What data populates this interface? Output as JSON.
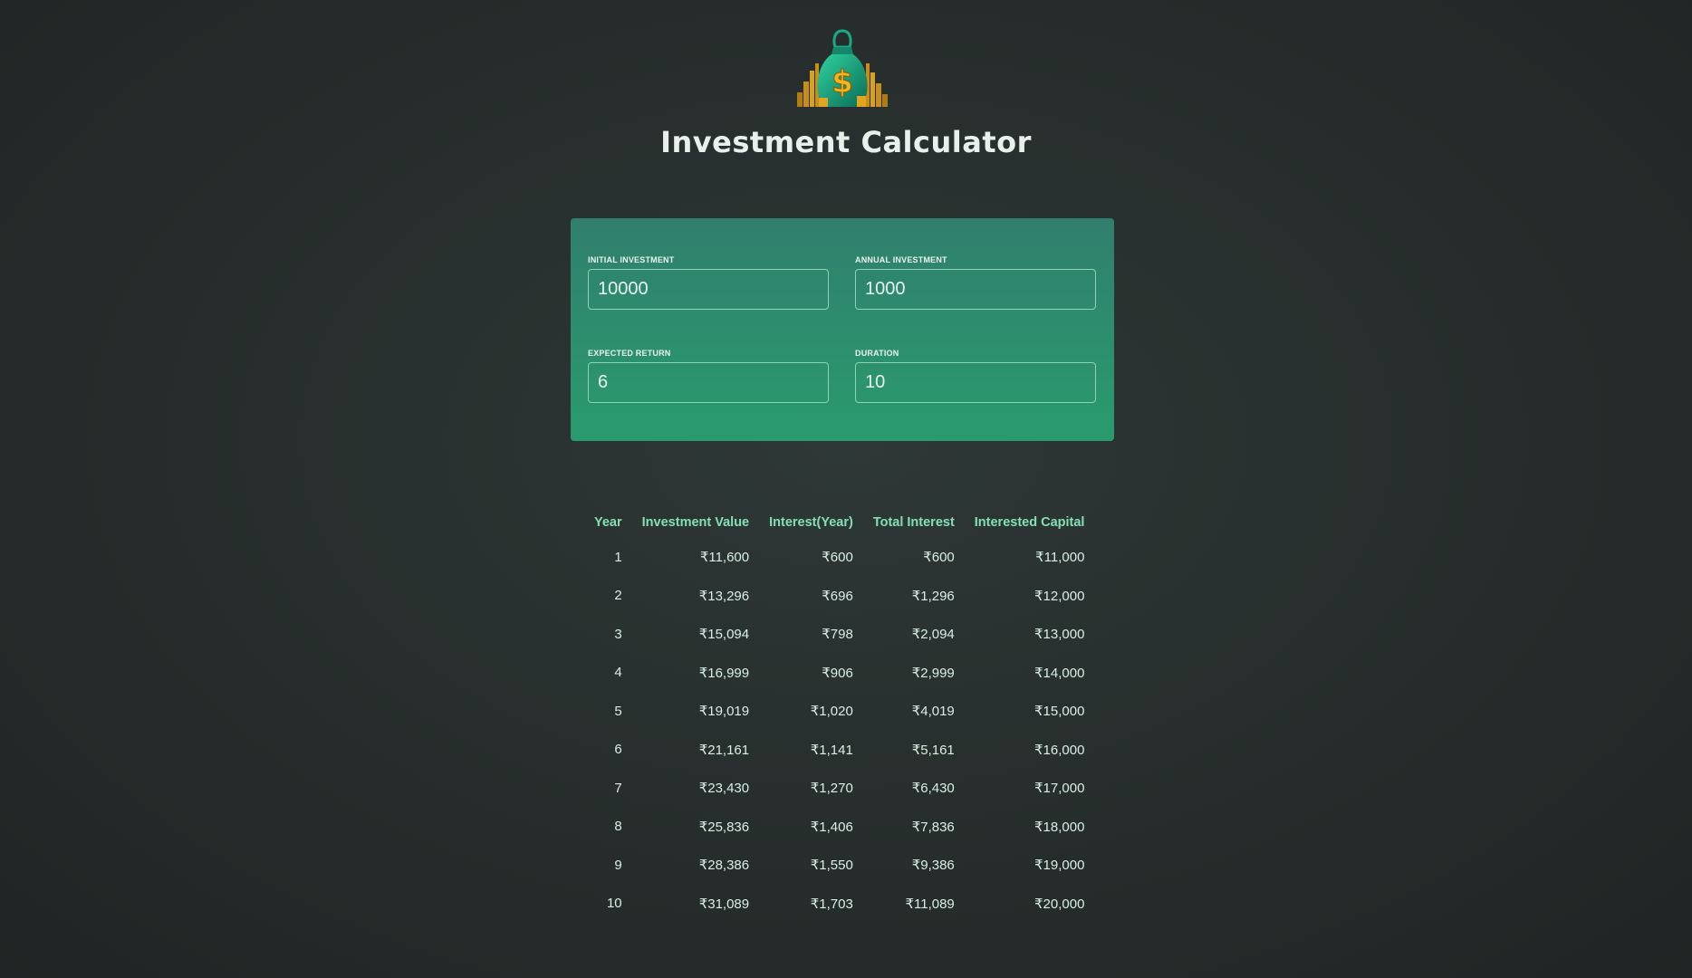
{
  "header": {
    "logo_icon": "money-bag-icon",
    "title": "Investment Calculator"
  },
  "inputs": {
    "initial_investment": {
      "label": "Initial Investment",
      "value": "10000"
    },
    "annual_investment": {
      "label": "Annual Investment",
      "value": "1000"
    },
    "expected_return": {
      "label": "Expected Return",
      "value": "6"
    },
    "duration": {
      "label": "Duration",
      "value": "10"
    }
  },
  "table": {
    "headers": [
      "Year",
      "Investment Value",
      "Interest(Year)",
      "Total Interest",
      "Interested Capital"
    ],
    "rows": [
      [
        "1",
        "₹11,600",
        "₹600",
        "₹600",
        "₹11,000"
      ],
      [
        "2",
        "₹13,296",
        "₹696",
        "₹1,296",
        "₹12,000"
      ],
      [
        "3",
        "₹15,094",
        "₹798",
        "₹2,094",
        "₹13,000"
      ],
      [
        "4",
        "₹16,999",
        "₹906",
        "₹2,999",
        "₹14,000"
      ],
      [
        "5",
        "₹19,019",
        "₹1,020",
        "₹4,019",
        "₹15,000"
      ],
      [
        "6",
        "₹21,161",
        "₹1,141",
        "₹5,161",
        "₹16,000"
      ],
      [
        "7",
        "₹23,430",
        "₹1,270",
        "₹6,430",
        "₹17,000"
      ],
      [
        "8",
        "₹25,836",
        "₹1,406",
        "₹7,836",
        "₹18,000"
      ],
      [
        "9",
        "₹28,386",
        "₹1,550",
        "₹9,386",
        "₹19,000"
      ],
      [
        "10",
        "₹31,089",
        "₹1,703",
        "₹11,089",
        "₹20,000"
      ]
    ]
  },
  "colors": {
    "background": "#262d2c",
    "panel_top": "#307f6d",
    "panel_bottom": "#2a9b6e",
    "table_header": "#84e0b4",
    "table_text": "#d9efe4",
    "coin_gold": "#d9a21e"
  }
}
